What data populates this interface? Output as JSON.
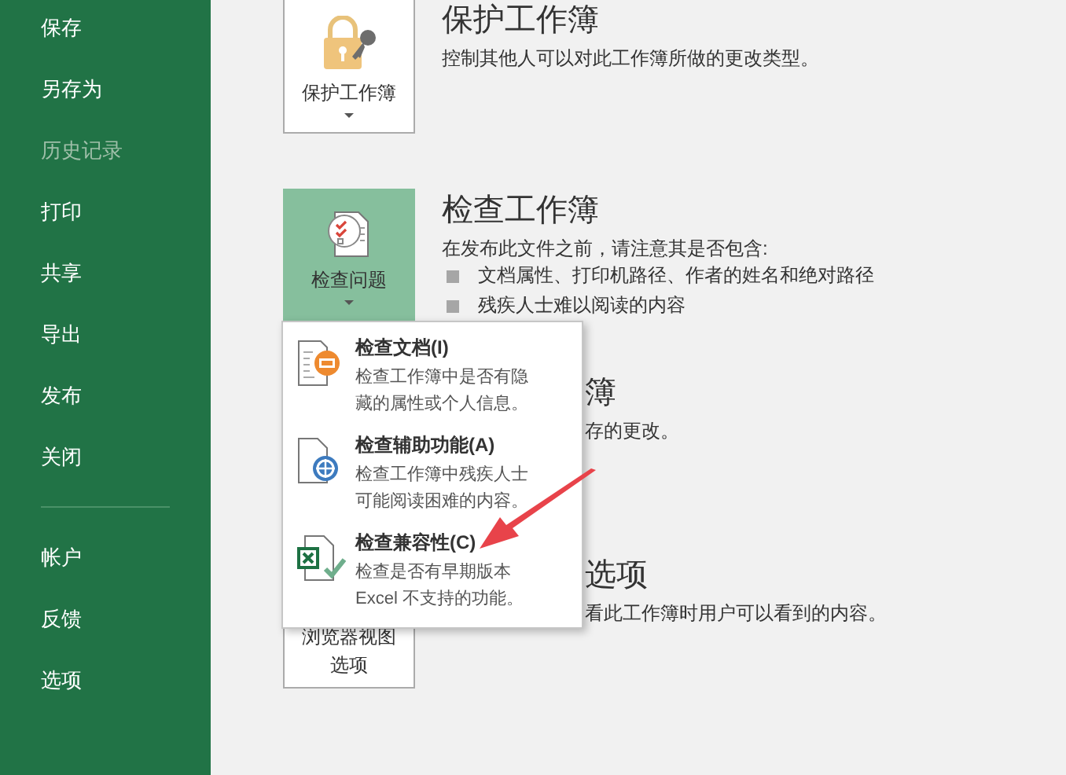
{
  "sidebar": {
    "items": [
      {
        "label": "保存",
        "disabled": false
      },
      {
        "label": "另存为",
        "disabled": false
      },
      {
        "label": "历史记录",
        "disabled": true
      },
      {
        "label": "打印",
        "disabled": false
      },
      {
        "label": "共享",
        "disabled": false
      },
      {
        "label": "导出",
        "disabled": false
      },
      {
        "label": "发布",
        "disabled": false
      },
      {
        "label": "关闭",
        "disabled": false
      }
    ],
    "footer_items": [
      {
        "label": "帐户",
        "disabled": false
      },
      {
        "label": "反馈",
        "disabled": false
      },
      {
        "label": "选项",
        "disabled": false
      }
    ]
  },
  "sections": [
    {
      "kind": "protect",
      "button": {
        "label": "保护工作簿",
        "active": false
      },
      "title": "保护工作簿",
      "description": "控制其他人可以对此工作簿所做的更改类型。"
    },
    {
      "kind": "inspect",
      "button": {
        "label": "检查问题",
        "active": true
      },
      "title": "检查工作簿",
      "description": "在发布此文件之前，请注意其是否包含:",
      "bullets": [
        "文档属性、打印机路径、作者的姓名和绝对路径",
        "残疾人士难以阅读的内容"
      ]
    },
    {
      "kind": "manage",
      "title": "簿",
      "description": "存的更改。"
    },
    {
      "kind": "browser",
      "button": {
        "label": "浏览器视图选项",
        "active": false
      },
      "title": "选项",
      "description": "看此工作簿时用户可以看到的内容。"
    }
  ],
  "dropdown_menu": {
    "items": [
      {
        "kind": "document",
        "title": "检查文档(I)",
        "description": "检查工作簿中是否有隐藏的属性或个人信息。"
      },
      {
        "kind": "accessibility",
        "title": "检查辅助功能(A)",
        "description": "检查工作簿中残疾人士可能阅读困难的内容。"
      },
      {
        "kind": "compatibility",
        "title": "检查兼容性(C)",
        "description": "检查是否有早期版本 Excel 不支持的功能。"
      }
    ]
  }
}
